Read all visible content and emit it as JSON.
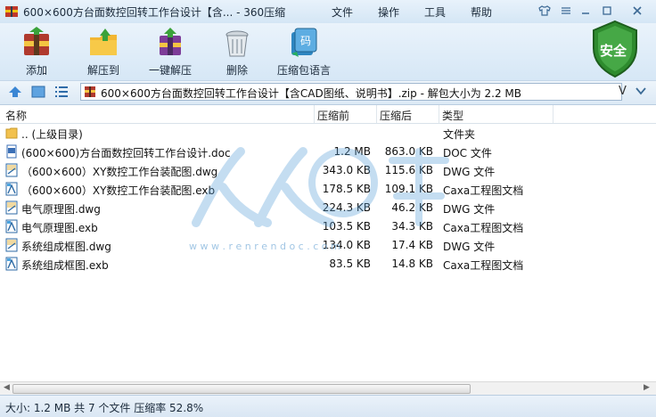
{
  "title": "600×600方台面数控回转工作台设计【含... - 360压缩",
  "menu": [
    "文件",
    "操作",
    "工具",
    "帮助"
  ],
  "toolbar": [
    {
      "label": "添加",
      "icon": "add-icon"
    },
    {
      "label": "解压到",
      "icon": "extract-to-icon"
    },
    {
      "label": "一键解压",
      "icon": "one-click-extract-icon"
    },
    {
      "label": "删除",
      "icon": "delete-icon"
    },
    {
      "label": "压缩包语言",
      "icon": "archive-language-icon"
    }
  ],
  "security": {
    "label": "安全"
  },
  "address": {
    "text": "600×600方台面数控回转工作台设计【含CAD图纸、说明书】.zip - 解包大小为 2.2 MB",
    "dropdown": "V"
  },
  "columns": {
    "name": "名称",
    "packed": "压缩前",
    "unpacked": "压缩后",
    "type": "类型"
  },
  "files": [
    {
      "name": ".. (上级目录)",
      "packed": "",
      "unpacked": "",
      "type": "文件夹",
      "icon": "folder-icon"
    },
    {
      "name": "(600×600)方台面数控回转工作台设计.doc",
      "packed": "1.2 MB",
      "unpacked": "863.0 KB",
      "type": "DOC 文件",
      "icon": "doc-icon"
    },
    {
      "name": "（600×600）XY数控工作台装配图.dwg",
      "packed": "343.0 KB",
      "unpacked": "115.6 KB",
      "type": "DWG 文件",
      "icon": "dwg-icon"
    },
    {
      "name": "（600×600）XY数控工作台装配图.exb",
      "packed": "178.5 KB",
      "unpacked": "109.1 KB",
      "type": "Caxa工程图文档",
      "icon": "exb-icon"
    },
    {
      "name": "电气原理图.dwg",
      "packed": "224.3 KB",
      "unpacked": "46.2 KB",
      "type": "DWG 文件",
      "icon": "dwg-icon"
    },
    {
      "name": "电气原理图.exb",
      "packed": "103.5 KB",
      "unpacked": "34.3 KB",
      "type": "Caxa工程图文档",
      "icon": "exb-icon"
    },
    {
      "name": "系统组成框图.dwg",
      "packed": "134.0 KB",
      "unpacked": "17.4 KB",
      "type": "DWG 文件",
      "icon": "dwg-icon"
    },
    {
      "name": "系统组成框图.exb",
      "packed": "83.5 KB",
      "unpacked": "14.8 KB",
      "type": "Caxa工程图文档",
      "icon": "exb-icon"
    }
  ],
  "status": "大小: 1.2 MB 共 7 个文件 压缩率 52.8%",
  "watermark_url": "w w w . r e n r e n d o c . c o m"
}
